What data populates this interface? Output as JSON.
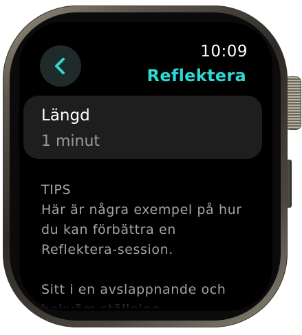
{
  "status": {
    "time": "10:09"
  },
  "header": {
    "back_icon": "chevron-left-icon",
    "app_title": "Reflektera"
  },
  "setting": {
    "label": "Längd",
    "value": "1 minut"
  },
  "tips": {
    "heading": "TIPS",
    "paragraph_1": "Här är några exempel på hur du kan förbättra en Reflektera-session.",
    "paragraph_2": "Sitt i en avslappnande och bekväm ställning."
  },
  "colors": {
    "accent": "#2fd9d3",
    "card": "#1e1e1f",
    "secondary_text": "#9a9a9e"
  }
}
